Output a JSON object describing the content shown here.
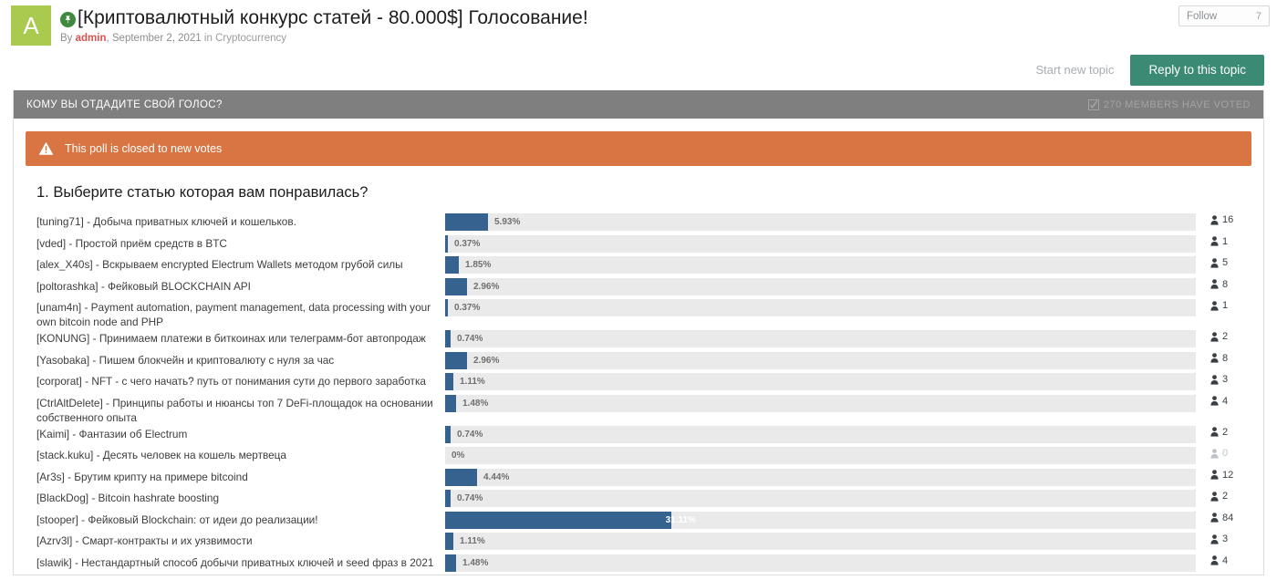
{
  "topic": {
    "avatar_letter": "A",
    "pin_icon": "pin-icon",
    "title": "[Криптовалютный конкурс статей - 80.000$] Голосование!",
    "by_word": "By",
    "author": "admin",
    "date": ", September 2, 2021 ",
    "in_word": "in",
    "forum": "Cryptocurrency",
    "follow_label": "Follow",
    "follow_count": "7"
  },
  "actions": {
    "start_new_topic": "Start new topic",
    "reply_to_topic": "Reply to this topic"
  },
  "poll": {
    "header_question": "КОМУ ВЫ ОТДАДИТЕ СВОЙ ГОЛОС?",
    "voted_text": "270 MEMBERS HAVE VOTED",
    "voted_icon": "checkbox-checked-icon",
    "closed_icon": "warning-triangle-icon",
    "closed_text": "This poll is closed to new votes",
    "question": "1. Выберите статью которая вам понравилась?",
    "vote_icon": "user-icon",
    "accent_bar_color": "#36628f",
    "track_color": "#eaeaea",
    "warning_color": "#d97543",
    "header_color": "#7f7f7f"
  },
  "chart_data": {
    "type": "bar",
    "title": "1. Выберите статью которая вам понравилась?",
    "xlabel": "",
    "ylabel": "",
    "grid": false,
    "total_voters": 270,
    "categories": [
      "[tuning71] - Добыча приватных ключей и кошельков.",
      "[vded] - Простой приём средств в BTC",
      "[alex_X40s] - Вскрываем encrypted Electrum Wallets методом грубой силы",
      "[poltorashka] - Фейковый BLOCKCHAIN API",
      "[unam4n] - Payment automation, payment management, data processing with your own bitcoin node and PHP",
      "[KONUNG] - Принимаем платежи в биткоинах или телеграмм-бот автопродаж",
      "[Yasobaka] - Пишем блокчейн и криптовалюту с нуля за час",
      "[corporat] - NFT - с чего начать? путь от понимания сути до первого заработка",
      "[CtrlAltDelete] - Принципы работы и нюансы топ 7 DeFi-площадок на основании собственного опыта",
      "[Kaimi] - Фантазии об Electrum",
      "[stack.kuku] - Десять человек на кошель мертвеца",
      "[Ar3s] - Брутим крипту на примере bitcoind",
      "[BlackDog] - Bitcoin hashrate boosting",
      "[stooper] - Фейковый Blockchain: от идеи до реализации!",
      "[Azrv3l] - Смарт-контракты и их уязвимости",
      "[slawik] - Нестандартный способ добычи приватных ключей и seed фраз в 2021"
    ],
    "percent_labels": [
      "5.93%",
      "0.37%",
      "1.85%",
      "2.96%",
      "0.37%",
      "0.74%",
      "2.96%",
      "1.11%",
      "1.48%",
      "0.74%",
      "0%",
      "4.44%",
      "0.74%",
      "31.11%",
      "1.11%",
      "1.48%"
    ],
    "values": [
      5.93,
      0.37,
      1.85,
      2.96,
      0.37,
      0.74,
      2.96,
      1.11,
      1.48,
      0.74,
      0,
      4.44,
      0.74,
      31.11,
      1.11,
      1.48
    ],
    "vote_counts": [
      "16",
      "1",
      "5",
      "8",
      "1",
      "2",
      "8",
      "3",
      "4",
      "2",
      "0",
      "12",
      "2",
      "84",
      "3",
      "4"
    ],
    "ylim": [
      0,
      100
    ]
  },
  "options": [
    {
      "label": "[tuning71] - Добыча приватных ключей и кошельков.",
      "pct": "5.93%",
      "value": 5.93,
      "votes": "16"
    },
    {
      "label": "[vded] - Простой приём средств в BTC",
      "pct": "0.37%",
      "value": 0.37,
      "votes": "1"
    },
    {
      "label": "[alex_X40s] - Вскрываем encrypted Electrum Wallets методом грубой силы",
      "pct": "1.85%",
      "value": 1.85,
      "votes": "5"
    },
    {
      "label": "[poltorashka] - Фейковый BLOCKCHAIN API",
      "pct": "2.96%",
      "value": 2.96,
      "votes": "8"
    },
    {
      "label": "[unam4n] - Payment automation, payment management, data processing with your own bitcoin node and PHP",
      "pct": "0.37%",
      "value": 0.37,
      "votes": "1"
    },
    {
      "label": "[KONUNG] - Принимаем платежи в биткоинах или телеграмм-бот автопродаж",
      "pct": "0.74%",
      "value": 0.74,
      "votes": "2"
    },
    {
      "label": "[Yasobaka] - Пишем блокчейн и криптовалюту с нуля за час",
      "pct": "2.96%",
      "value": 2.96,
      "votes": "8"
    },
    {
      "label": "[corporat] - NFT - с чего начать? путь от понимания сути до первого заработка",
      "pct": "1.11%",
      "value": 1.11,
      "votes": "3"
    },
    {
      "label": "[CtrlAltDelete] - Принципы работы и нюансы топ 7 DeFi-площадок на основании собственного опыта",
      "pct": "1.48%",
      "value": 1.48,
      "votes": "4"
    },
    {
      "label": "[Kaimi] - Фантазии об Electrum",
      "pct": "0.74%",
      "value": 0.74,
      "votes": "2"
    },
    {
      "label": "[stack.kuku] - Десять человек на кошель мертвеца",
      "pct": "0%",
      "value": 0,
      "votes": "0"
    },
    {
      "label": "[Ar3s] - Брутим крипту на примере bitcoind",
      "pct": "4.44%",
      "value": 4.44,
      "votes": "12"
    },
    {
      "label": "[BlackDog] - Bitcoin hashrate boosting",
      "pct": "0.74%",
      "value": 0.74,
      "votes": "2"
    },
    {
      "label": "[stooper] - Фейковый Blockchain: от идеи до реализации!",
      "pct": "31.11%",
      "value": 31.11,
      "votes": "84"
    },
    {
      "label": "[Azrv3l] - Смарт-контракты и их уязвимости",
      "pct": "1.11%",
      "value": 1.11,
      "votes": "3"
    },
    {
      "label": "[slawik] - Нестандартный способ добычи приватных ключей и seed фраз в 2021",
      "pct": "1.48%",
      "value": 1.48,
      "votes": "4"
    }
  ]
}
